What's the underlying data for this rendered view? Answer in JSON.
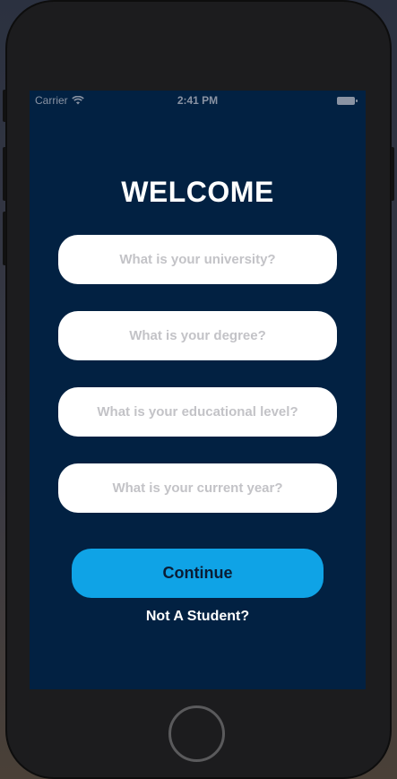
{
  "status_bar": {
    "carrier": "Carrier",
    "time": "2:41 PM"
  },
  "welcome": {
    "title": "WELCOME",
    "university_placeholder": "What is your university?",
    "degree_placeholder": "What is your degree?",
    "level_placeholder": "What is your educational level?",
    "year_placeholder": "What is your current year?",
    "continue_label": "Continue",
    "not_student_label": "Not A Student?"
  },
  "colors": {
    "screen_background": "#022142",
    "continue_button": "#0fa3e6",
    "field_background": "#ffffff"
  }
}
